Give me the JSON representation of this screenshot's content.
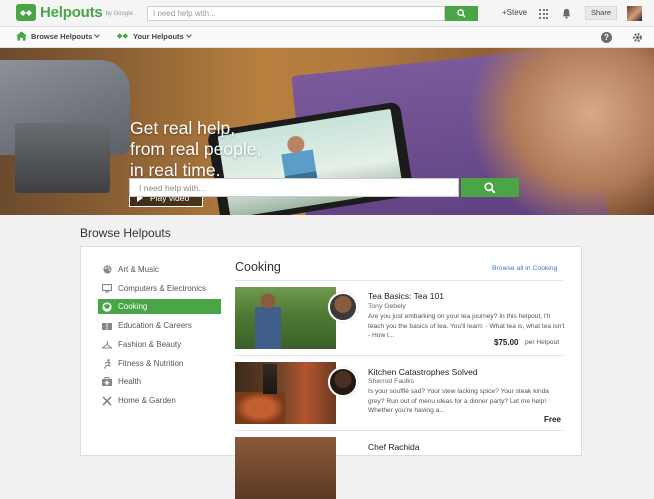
{
  "header": {
    "brand": "Helpouts",
    "brand_by": "by Google",
    "search_placeholder": "I need help with...",
    "user_link": "+Steve",
    "share_label": "Share"
  },
  "subnav": {
    "browse_label": "Browse Helpouts",
    "your_label": "Your Helpouts"
  },
  "hero": {
    "headline_1": "Get real help,",
    "headline_2": "from real people,",
    "headline_3": "in real time.",
    "play_label": "Play video",
    "search_placeholder": "I need help with..."
  },
  "browse": {
    "title": "Browse Helpouts",
    "categories": [
      {
        "label": "Art & Music",
        "icon": "palette-icon"
      },
      {
        "label": "Computers & Electronics",
        "icon": "monitor-icon"
      },
      {
        "label": "Cooking",
        "icon": "chef-hat-icon",
        "active": true
      },
      {
        "label": "Education & Careers",
        "icon": "book-icon"
      },
      {
        "label": "Fashion & Beauty",
        "icon": "hanger-icon"
      },
      {
        "label": "Fitness & Nutrition",
        "icon": "runner-icon"
      },
      {
        "label": "Health",
        "icon": "first-aid-icon"
      },
      {
        "label": "Home & Garden",
        "icon": "tools-icon"
      }
    ],
    "list_title": "Cooking",
    "browse_all": "Browse all in Cooking",
    "items": [
      {
        "title": "Tea Basics: Tea 101",
        "author": "Tony Gebely",
        "description": "Are you just embarking on your tea journey? In this helpout, I'll teach you the basics of tea. You'll learn: - What tea is, what tea isn't - How t...",
        "price": "$75.00",
        "price_unit": "per Helpout"
      },
      {
        "title": "Kitchen Catastrophes Solved",
        "author": "Sherrod Faulks",
        "description": "Is your soufflé sad? Your stew lacking spice? Your steak kinda grey? Run out of menu ideas for a dinner party? Let me help! Whether you're having a...",
        "price": "Free"
      },
      {
        "title": "Chef Rachida"
      }
    ]
  },
  "colors": {
    "brand_green": "#4aa546",
    "link_blue": "#3b78c4"
  }
}
